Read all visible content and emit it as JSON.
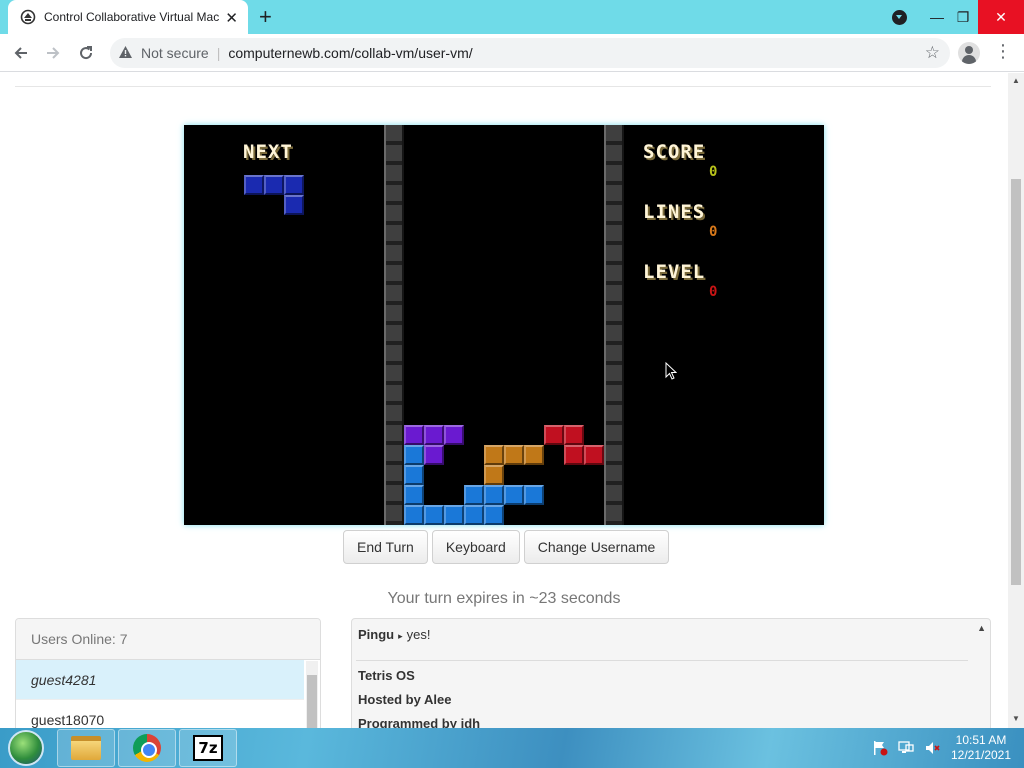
{
  "browser": {
    "tab_title": "Control Collaborative Virtual Machine",
    "tab_close_glyph": "✕",
    "new_tab_glyph": "+",
    "security_label": "Not secure",
    "url": "computernewb.com/collab-vm/user-vm/",
    "icons": {
      "back": "arrow-left-icon",
      "forward": "arrow-right-icon",
      "reload": "reload-icon",
      "star": "star-icon",
      "menu": "kebab-menu-icon"
    },
    "window_controls": {
      "minimize": "—",
      "restore": "❐",
      "close": "✕"
    }
  },
  "vm": {
    "next_label": "NEXT",
    "score_label": "SCORE",
    "score_value": "0",
    "lines_label": "LINES",
    "lines_value": "0",
    "level_label": "LEVEL",
    "level_value": "0",
    "colors": {
      "score": "#b8c21a",
      "lines": "#d8781a",
      "level": "#c81414"
    }
  },
  "controls": {
    "end_turn": "End Turn",
    "keyboard": "Keyboard",
    "change_username": "Change Username"
  },
  "turn_text": "Your turn expires in ~23 seconds",
  "users": {
    "header": "Users Online: 7",
    "list": [
      "guest4281",
      "guest18070"
    ]
  },
  "chat": {
    "message_user": "Pingu",
    "message_arrow": "▸",
    "message_text": "yes!",
    "info_lines": [
      "Tetris OS",
      "Hosted by Alee",
      "Programmed by jdh"
    ]
  },
  "taskbar": {
    "apps": [
      "file-explorer-icon",
      "chrome-icon",
      "7zip-icon"
    ],
    "sevenz_label": "7z",
    "time": "10:51 AM",
    "date": "12/21/2021"
  }
}
